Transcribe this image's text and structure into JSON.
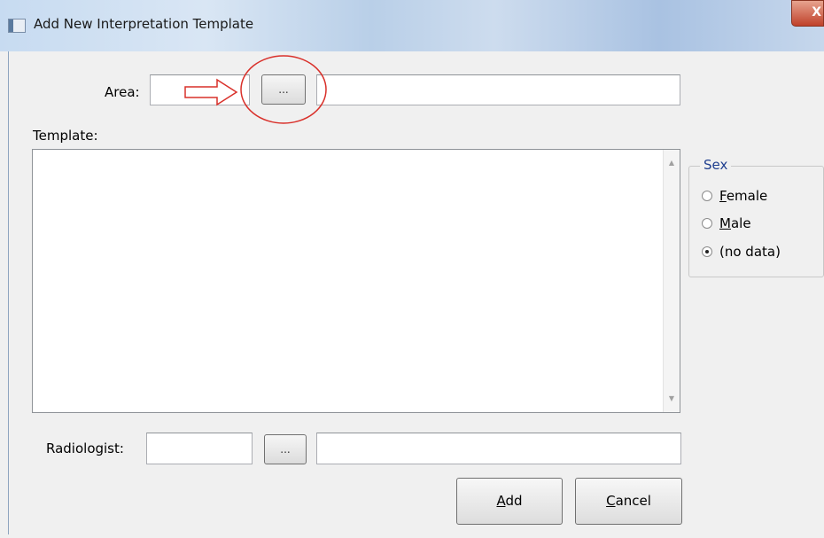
{
  "window": {
    "title": "Add New Interpretation Template",
    "close_glyph": "X"
  },
  "area": {
    "label": "Area:",
    "code_value": "",
    "browse_label": "...",
    "name_value": ""
  },
  "template": {
    "label": "Template:",
    "value": ""
  },
  "sex": {
    "title": "Sex",
    "options": [
      {
        "prefix": "",
        "accel": "F",
        "rest": "emale",
        "checked": false
      },
      {
        "prefix": "",
        "accel": "M",
        "rest": "ale",
        "checked": false
      },
      {
        "prefix": "(no data)",
        "accel": "",
        "rest": "",
        "checked": true
      }
    ]
  },
  "radiologist": {
    "label": "Radiologist:",
    "code_value": "",
    "browse_label": "...",
    "name_value": ""
  },
  "buttons": {
    "add": {
      "accel": "A",
      "rest": "dd"
    },
    "cancel": {
      "accel": "C",
      "rest": "ancel"
    }
  },
  "annotation": {
    "arrow_color": "#d9302a",
    "circle_color": "#d9302a"
  }
}
